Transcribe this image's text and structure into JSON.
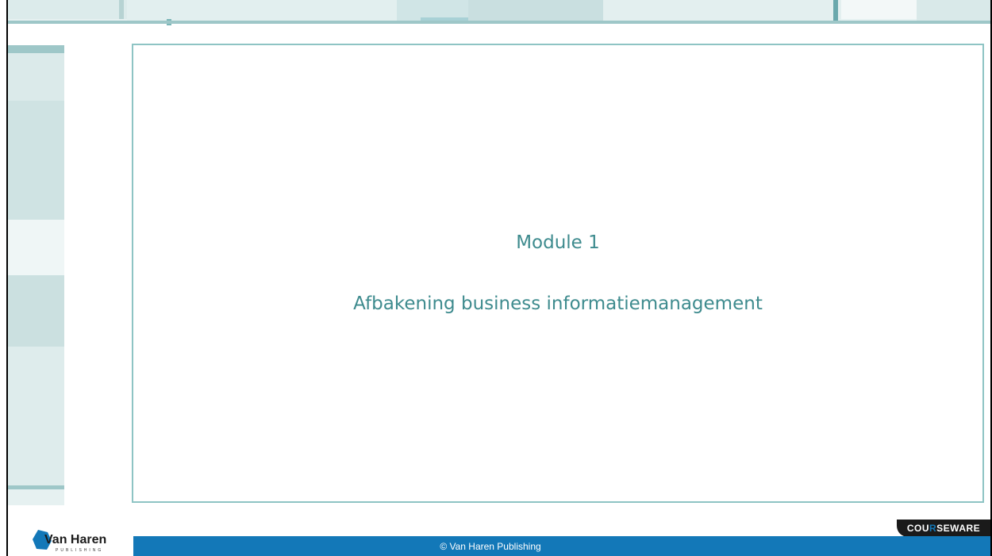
{
  "slide": {
    "title": "Module 1",
    "subtitle": "Afbakening business informatiemanagement"
  },
  "footer": {
    "copyright": "© Van Haren Publishing"
  },
  "badge": {
    "text_before": "COU",
    "text_r": "R",
    "text_after": "SEWARE"
  },
  "logo": {
    "name": "Van Haren",
    "tagline": "PUBLISHING"
  },
  "colors": {
    "accent_teal": "#3e8b8e",
    "slide_border": "#8ec4c4",
    "footer_blue": "#1378b8",
    "badge_dark": "#1a1a1a"
  }
}
